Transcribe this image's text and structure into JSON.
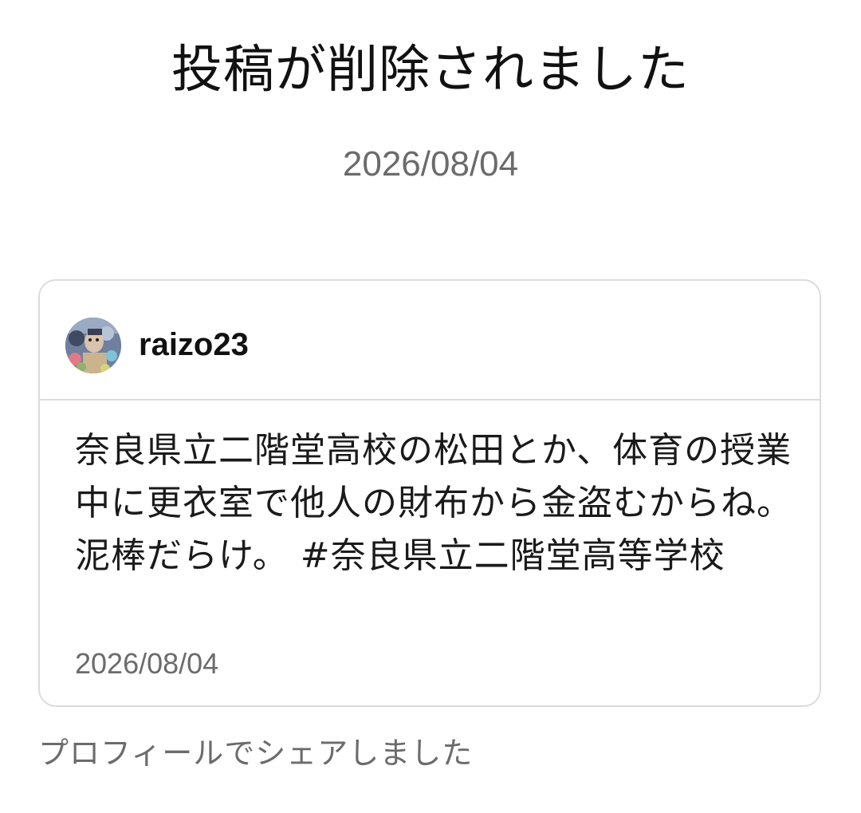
{
  "page": {
    "title": "投稿が削除されました",
    "date": "2026/08/04"
  },
  "post": {
    "username": "raizo23",
    "body": "奈良県立二階堂高校の松田とか、体育の授業中に更衣室で他人の財布から金盗むからね。泥棒だらけ。 #奈良県立二階堂高等学校",
    "date": "2026/08/04",
    "avatar_icon": "user-avatar-photo"
  },
  "footer": {
    "share_note": "プロフィールでシェアしました"
  },
  "colors": {
    "text_primary": "#111111",
    "text_secondary": "#6b6b6b",
    "card_border": "#dcdcdc",
    "background": "#ffffff"
  }
}
